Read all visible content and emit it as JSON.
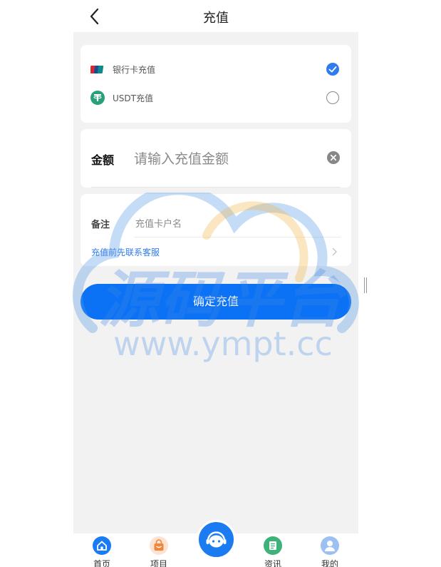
{
  "header": {
    "title": "充值"
  },
  "methods": [
    {
      "label": "银行卡充值",
      "icon": "unionpay-icon",
      "checked": true
    },
    {
      "label": "USDT充值",
      "icon": "tether-icon",
      "checked": false
    }
  ],
  "amount": {
    "label": "金额",
    "placeholder": "请输入充值金额",
    "value": ""
  },
  "remark": {
    "label": "备注",
    "placeholder": "充值卡户名",
    "value": "",
    "service_link": "充值前先联系客服"
  },
  "confirm_label": "确定充值",
  "watermark": {
    "text": "源码平台",
    "url": "www.ympt.cc"
  },
  "tabs": [
    {
      "label": "首页",
      "icon": "home-icon"
    },
    {
      "label": "项目",
      "icon": "bag-icon"
    },
    {
      "label": "",
      "icon": "customer-service-icon"
    },
    {
      "label": "资讯",
      "icon": "news-icon"
    },
    {
      "label": "我的",
      "icon": "user-icon"
    }
  ],
  "colors": {
    "accent": "#0b72f5",
    "check": "#2f7bf0",
    "tether": "#26a17b",
    "bag": "#f0863c",
    "news": "#3db37a"
  }
}
